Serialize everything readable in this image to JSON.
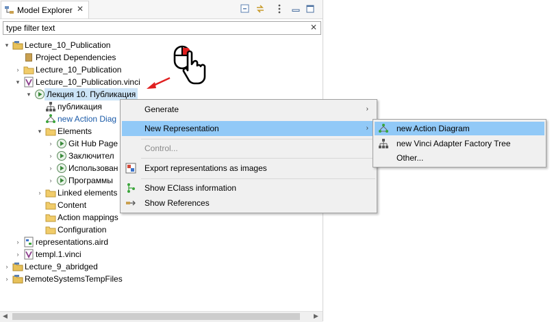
{
  "view": {
    "title": "Model Explorer",
    "filter_placeholder": "type filter text",
    "filter_value": "type filter text"
  },
  "tree": [
    {
      "label": "Lecture_10_Publication",
      "icon": "project-icon"
    },
    {
      "label": "Project Dependencies",
      "icon": "dependencies-icon"
    },
    {
      "label": "Lecture_10_Publication",
      "icon": "folder-icon"
    },
    {
      "label": "Lecture_10_Publication.vinci",
      "icon": "vinci-file-icon"
    },
    {
      "label": "Лекция  10. Публикация",
      "icon": "play-node-icon"
    },
    {
      "label": "публикация",
      "icon": "tree-diagram-icon"
    },
    {
      "label": "new Action Diag",
      "icon": "action-diagram-icon"
    },
    {
      "label": "Elements",
      "icon": "folder-icon"
    },
    {
      "label": "Git Hub Page",
      "icon": "play-node-icon"
    },
    {
      "label": "Заключител",
      "icon": "play-node-icon"
    },
    {
      "label": "Использован",
      "icon": "play-node-icon"
    },
    {
      "label": "Программы",
      "icon": "play-node-icon"
    },
    {
      "label": "Linked elements",
      "icon": "folder-icon"
    },
    {
      "label": "Content",
      "icon": "folder-icon"
    },
    {
      "label": "Action mappings",
      "icon": "folder-icon"
    },
    {
      "label": "Configuration",
      "icon": "folder-icon"
    },
    {
      "label": "representations.aird",
      "icon": "aird-file-icon"
    },
    {
      "label": "templ.1.vinci",
      "icon": "vinci-file-icon"
    },
    {
      "label": "Lecture_9_abridged",
      "icon": "project-icon"
    },
    {
      "label": "RemoteSystemsTempFiles",
      "icon": "project-icon"
    }
  ],
  "context_menu": [
    {
      "label": "Generate",
      "arrow": "›"
    },
    {
      "label": "New Representation",
      "arrow": "›"
    },
    {
      "label": "Control..."
    },
    {
      "label": "Export representations as images"
    },
    {
      "label": "Show EClass information"
    },
    {
      "label": "Show References"
    }
  ],
  "submenu": [
    {
      "label": "new Action Diagram"
    },
    {
      "label": "new Vinci Adapter Factory Tree"
    },
    {
      "label": "Other..."
    }
  ],
  "colors": {
    "selection": "#cce4f7",
    "menu_highlight": "#91c9f7",
    "annotation_arrow": "#e02020"
  }
}
